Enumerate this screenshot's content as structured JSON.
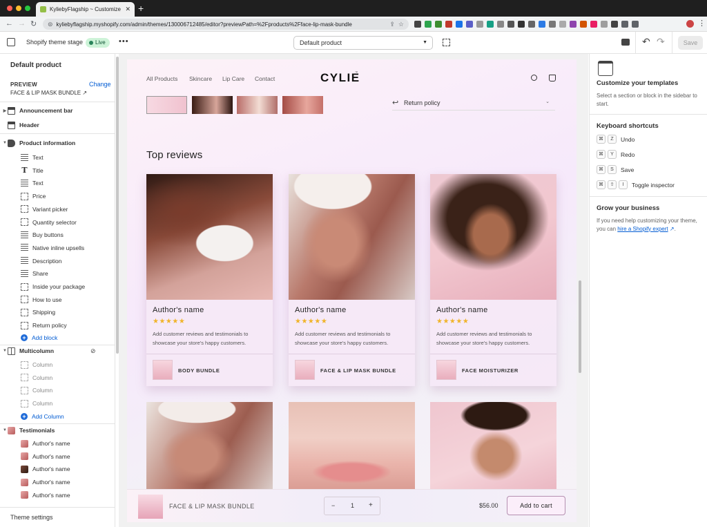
{
  "browser": {
    "tab_title": "KyliebyFlagship ~ Customize Sh...",
    "url": "kyliebyflagship.myshopify.com/admin/themes/130006712485/editor?previewPath=%2Fproducts%2Fface-lip-mask-bundle",
    "traffic_colors": [
      "#ff5f57",
      "#febc2e",
      "#28c840"
    ]
  },
  "editor": {
    "theme_name": "Shopify theme stage",
    "live_badge": "Live",
    "template_selected": "Default product",
    "save_label": "Save"
  },
  "sidebar": {
    "title": "Default product",
    "preview_label": "PREVIEW",
    "change_label": "Change",
    "preview_value": "FACE & LIP MASK BUNDLE",
    "announcement_bar": "Announcement bar",
    "header": "Header",
    "product_information": "Product information",
    "product_blocks": [
      {
        "label": "Text",
        "icon": "text-lines-icon"
      },
      {
        "label": "Title",
        "icon": "title-icon"
      },
      {
        "label": "Text",
        "icon": "text-lines-icon"
      },
      {
        "label": "Price",
        "icon": "dashed-block-icon"
      },
      {
        "label": "Variant picker",
        "icon": "dashed-block-icon"
      },
      {
        "label": "Quantity selector",
        "icon": "dashed-block-icon"
      },
      {
        "label": "Buy buttons",
        "icon": "text-lines-icon"
      },
      {
        "label": "Native inline upsells",
        "icon": "text-lines-icon"
      },
      {
        "label": "Description",
        "icon": "text-lines-icon"
      },
      {
        "label": "Share",
        "icon": "text-lines-icon"
      },
      {
        "label": "Inside your package",
        "icon": "dashed-block-icon"
      },
      {
        "label": "How to use",
        "icon": "dashed-block-icon"
      },
      {
        "label": "Shipping",
        "icon": "dashed-block-icon"
      },
      {
        "label": "Return policy",
        "icon": "dashed-block-icon"
      }
    ],
    "add_block": "Add block",
    "multicolumn": "Multicolumn",
    "columns": [
      "Column",
      "Column",
      "Column",
      "Column"
    ],
    "add_column": "Add Column",
    "testimonials": "Testimonials",
    "testimonial_items": [
      "Author's name",
      "Author's name",
      "Author's name",
      "Author's name",
      "Author's name"
    ],
    "theme_settings": "Theme settings"
  },
  "store": {
    "nav": [
      "All Products",
      "Skincare",
      "Lip Care",
      "Contact"
    ],
    "logo": "CYLIE",
    "logo_tm": "™",
    "return_policy": "Return policy",
    "reviews_heading": "Top reviews",
    "reviews": [
      {
        "name": "Author's name",
        "stars": "★★★★★",
        "text": "Add customer reviews and testimonials to showcase your store's happy customers.",
        "product": "BODY BUNDLE"
      },
      {
        "name": "Author's name",
        "stars": "★★★★★",
        "text": "Add customer reviews and testimonials to showcase your store's happy customers.",
        "product": "FACE & LIP MASK BUNDLE"
      },
      {
        "name": "Author's name",
        "stars": "★★★★★",
        "text": "Add customer reviews and testimonials to showcase your store's happy customers.",
        "product": "FACE MOISTURIZER"
      }
    ],
    "sticky": {
      "product_name": "FACE & LIP MASK BUNDLE",
      "quantity": "1",
      "minus": "−",
      "plus": "+",
      "price": "$56.00",
      "add_to_cart": "Add to cart"
    }
  },
  "right_panel": {
    "title": "Customize your templates",
    "description": "Select a section or block in the sidebar to start.",
    "shortcuts_heading": "Keyboard shortcuts",
    "shortcuts": [
      {
        "keys": [
          "⌘",
          "Z"
        ],
        "label": "Undo"
      },
      {
        "keys": [
          "⌘",
          "Y"
        ],
        "label": "Redo"
      },
      {
        "keys": [
          "⌘",
          "S"
        ],
        "label": "Save"
      },
      {
        "keys": [
          "⌘",
          "⇧",
          "I"
        ],
        "label": "Toggle inspector"
      }
    ],
    "grow_heading": "Grow your business",
    "grow_text_1": "If you need help customizing your theme, you can ",
    "grow_link": "hire a Shopify expert",
    "grow_text_2": "."
  }
}
